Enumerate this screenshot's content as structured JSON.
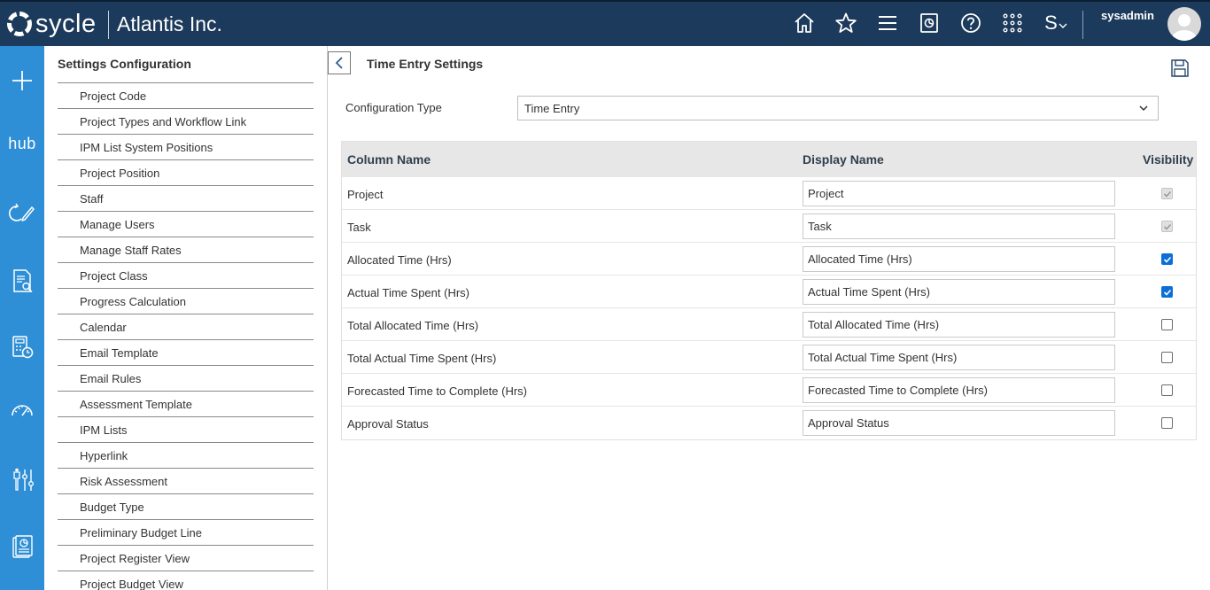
{
  "header": {
    "logo_text": "sycle",
    "company": "Atlantis Inc.",
    "username": "sysadmin",
    "icons": [
      "home-icon",
      "star-icon",
      "menu-icon",
      "reports-icon",
      "help-icon",
      "apps-grid-icon",
      "language-icon"
    ],
    "language_glyph": "S",
    "brand_color": "#1c3a5b"
  },
  "rail": {
    "color": "#2e8fd6",
    "hub_label": "hub",
    "icons": [
      "add-icon",
      "hub-icon",
      "edit-cycle-icon",
      "document-search-icon",
      "calculator-clock-icon",
      "gauge-icon",
      "staff-settings-icon",
      "report-icon"
    ]
  },
  "settings": {
    "title": "Settings Configuration",
    "items": [
      "Project Code",
      "Project Types and Workflow Link",
      "IPM List System Positions",
      "Project Position",
      "Staff",
      "Manage Users",
      "Manage Staff Rates",
      "Project Class",
      "Progress Calculation",
      "Calendar",
      "Email Template",
      "Email Rules",
      "Assessment Template",
      "IPM Lists",
      "Hyperlink",
      "Risk Assessment",
      "Budget Type",
      "Preliminary Budget Line",
      "Project Register View",
      "Project Budget View"
    ]
  },
  "main": {
    "title": "Time Entry Settings",
    "config_label": "Configuration Type",
    "config_value": "Time Entry",
    "columns": {
      "column_name": "Column Name",
      "display_name": "Display Name",
      "visibility": "Visibility"
    },
    "rows": [
      {
        "column": "Project",
        "display": "Project",
        "visible": true,
        "disabled": true
      },
      {
        "column": "Task",
        "display": "Task",
        "visible": true,
        "disabled": true
      },
      {
        "column": "Allocated Time (Hrs)",
        "display": "Allocated Time (Hrs)",
        "visible": true,
        "disabled": false
      },
      {
        "column": "Actual Time Spent (Hrs)",
        "display": "Actual Time Spent (Hrs)",
        "visible": true,
        "disabled": false
      },
      {
        "column": "Total Allocated Time (Hrs)",
        "display": "Total Allocated Time (Hrs)",
        "visible": false,
        "disabled": false
      },
      {
        "column": "Total Actual Time Spent (Hrs)",
        "display": "Total Actual Time Spent (Hrs)",
        "visible": false,
        "disabled": false
      },
      {
        "column": "Forecasted Time to Complete (Hrs)",
        "display": "Forecasted Time to Complete (Hrs)",
        "visible": false,
        "disabled": false
      },
      {
        "column": "Approval Status",
        "display": "Approval Status",
        "visible": false,
        "disabled": false
      }
    ]
  }
}
